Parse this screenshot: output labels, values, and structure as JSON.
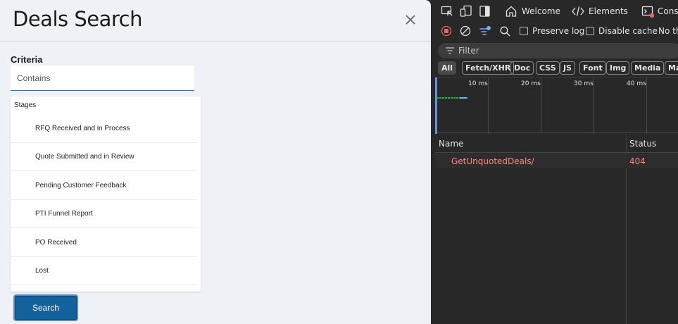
{
  "app": {
    "title": "Deals Search",
    "criteria_label": "Criteria",
    "criteria_placeholder": "Contains",
    "stages_header": "Stages",
    "stages": [
      "RFQ Received and in Process",
      "Quote Submitted and in Review",
      "Pending Customer Feedback",
      "PTI Funnel Report",
      "PO Received",
      "Lost"
    ],
    "search_label": "Search"
  },
  "devtools": {
    "tabs": {
      "welcome": "Welcome",
      "elements": "Elements",
      "console": "Conso"
    },
    "preserve_log": "Preserve log",
    "disable_cache": "Disable cache",
    "throttle": "No th",
    "filter_label": "Filter",
    "type_filters": [
      "All",
      "Fetch/XHR",
      "Doc",
      "CSS",
      "JS",
      "Font",
      "Img",
      "Media",
      "Ma"
    ],
    "timeline_labels": [
      "10 ms",
      "20 ms",
      "30 ms",
      "40 ms"
    ],
    "columns": {
      "name": "Name",
      "status": "Status"
    },
    "requests": [
      {
        "name": "GetUnquotedDeals/",
        "status": "404"
      }
    ],
    "colors": {
      "error": "#f28b82",
      "record": "#e46962",
      "accent": "#7cacf8"
    }
  }
}
